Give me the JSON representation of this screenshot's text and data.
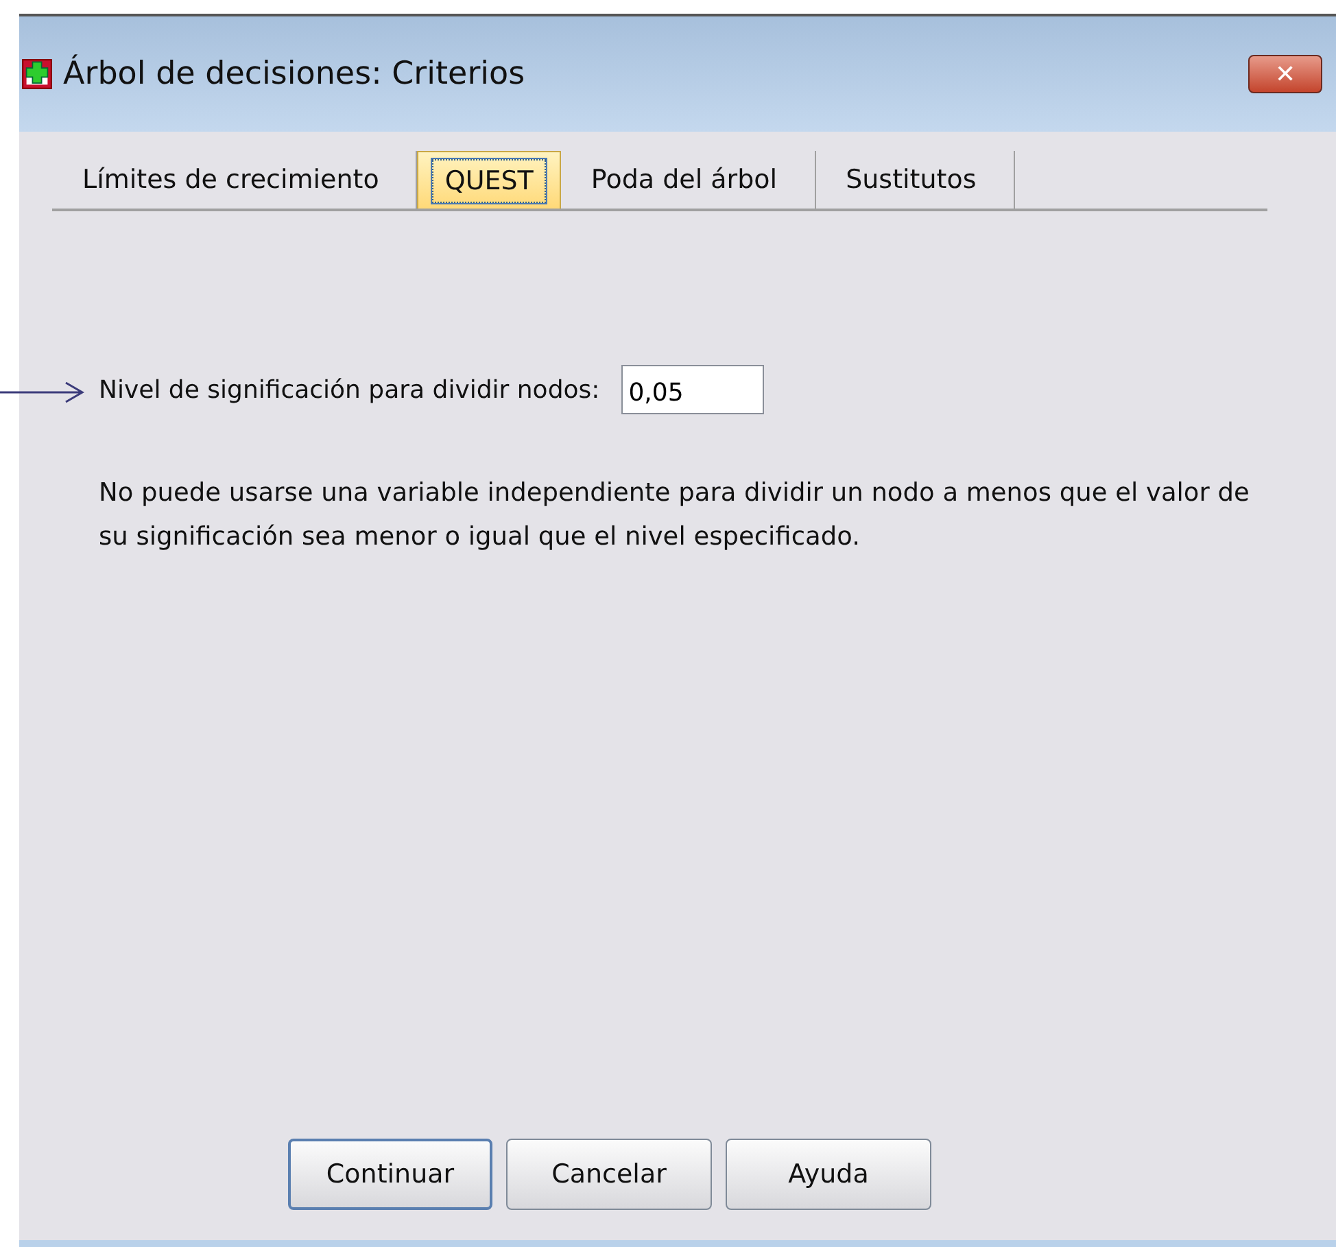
{
  "window": {
    "title": "Árbol de decisiones: Criterios",
    "close_label": "✕"
  },
  "tabs": [
    {
      "label": "Límites de crecimiento",
      "selected": false
    },
    {
      "label": "QUEST",
      "selected": true
    },
    {
      "label": "Poda del árbol",
      "selected": false
    },
    {
      "label": "Sustitutos",
      "selected": false
    }
  ],
  "field": {
    "label": "Nivel de significación para dividir nodos:",
    "value": "0,05"
  },
  "note": "No puede usarse una variable independiente para dividir un nodo a menos que el valor de su significación sea menor o igual que el nivel especificado.",
  "buttons": [
    {
      "label": "Continuar",
      "default": true
    },
    {
      "label": "Cancelar",
      "default": false
    },
    {
      "label": "Ayuda",
      "default": false
    }
  ]
}
